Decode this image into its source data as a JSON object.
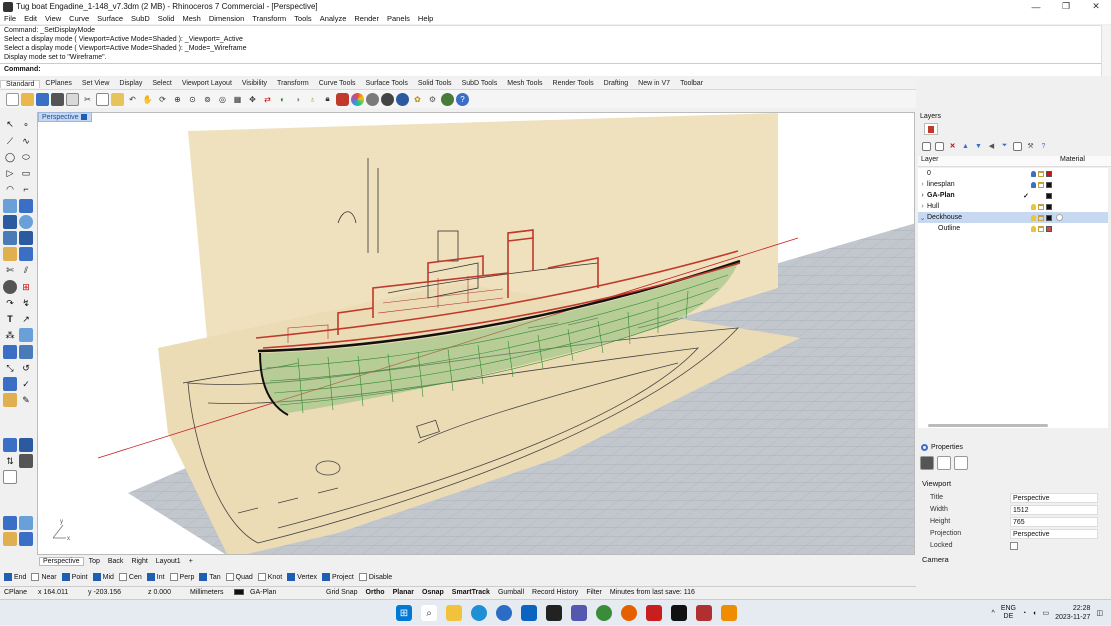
{
  "window": {
    "title": "Tug boat Engadine_1-148_v7.3dm (2 MB) - Rhinoceros 7 Commercial - [Perspective]",
    "minimize": "—",
    "maximize": "❐",
    "close": "✕"
  },
  "menu": [
    "File",
    "Edit",
    "View",
    "Curve",
    "Surface",
    "SubD",
    "Solid",
    "Mesh",
    "Dimension",
    "Transform",
    "Tools",
    "Analyze",
    "Render",
    "Panels",
    "Help"
  ],
  "command_history": [
    "Command: _SetDisplayMode",
    "Select a display mode ( Viewport=Active  Mode=Shaded ): _Viewport=_Active",
    "Select a display mode ( Viewport=Active  Mode=Shaded ): _Mode=_Wireframe",
    "Display mode set to \"Wireframe\"."
  ],
  "command_prompt": "Command:",
  "toolbar_tabs": [
    "Standard",
    "CPlanes",
    "Set View",
    "Display",
    "Select",
    "Viewport Layout",
    "Visibility",
    "Transform",
    "Curve Tools",
    "Surface Tools",
    "Solid Tools",
    "SubD Tools",
    "Mesh Tools",
    "Render Tools",
    "Drafting",
    "New in V7",
    "Toolbar"
  ],
  "toolbar_icons": [
    "new-file-icon",
    "open-icon",
    "save-icon",
    "print-icon",
    "import-icon",
    "cut-icon",
    "copy-icon",
    "paste-icon",
    "undo-icon",
    "pan-icon",
    "rotate-view-icon",
    "zoom-icon",
    "zoom-window-icon",
    "zoom-extents-icon",
    "zoom-selected-icon",
    "grid-icon",
    "move-icon",
    "copy-object-icon",
    "hide-icon",
    "show-icon",
    "lock-icon",
    "layer-icon",
    "color-icon",
    "shaded-icon",
    "rendered-icon",
    "render-icon",
    "mesh-icon",
    "options-icon",
    "help-icon"
  ],
  "viewport": {
    "active_label": "Perspective",
    "tabs": [
      "Perspective",
      "Top",
      "Back",
      "Right",
      "Layout1"
    ],
    "add_tab": "+",
    "axis_label_x": "x",
    "axis_label_y": "y"
  },
  "osnaps": [
    {
      "label": "End",
      "checked": true
    },
    {
      "label": "Near",
      "checked": false
    },
    {
      "label": "Point",
      "checked": true
    },
    {
      "label": "Mid",
      "checked": true
    },
    {
      "label": "Cen",
      "checked": false
    },
    {
      "label": "Int",
      "checked": true
    },
    {
      "label": "Perp",
      "checked": false
    },
    {
      "label": "Tan",
      "checked": true
    },
    {
      "label": "Quad",
      "checked": false
    },
    {
      "label": "Knot",
      "checked": false
    },
    {
      "label": "Vertex",
      "checked": true
    },
    {
      "label": "Project",
      "checked": true
    },
    {
      "label": "Disable",
      "checked": false
    }
  ],
  "status": {
    "cplane": "CPlane",
    "x": "x 164.011",
    "y": "y -203.156",
    "z": "z 0.000",
    "units": "Millimeters",
    "layer": "GA-Plan",
    "toggles": [
      {
        "label": "Grid Snap",
        "bold": false
      },
      {
        "label": "Ortho",
        "bold": true
      },
      {
        "label": "Planar",
        "bold": true
      },
      {
        "label": "Osnap",
        "bold": true
      },
      {
        "label": "SmartTrack",
        "bold": true
      },
      {
        "label": "Gumball",
        "bold": false
      },
      {
        "label": "Record History",
        "bold": false
      },
      {
        "label": "Filter",
        "bold": false
      }
    ],
    "last_save": "Minutes from last save: 116"
  },
  "layers_panel": {
    "title": "Layers",
    "col_layer": "Layer",
    "col_material": "Material",
    "rows": [
      {
        "name": "0",
        "expand": "",
        "current": "",
        "color": "#cc1111",
        "bold": false,
        "selected": false,
        "indent": false,
        "bulb": "blue"
      },
      {
        "name": "linesplan",
        "expand": "›",
        "current": "",
        "color": "#111111",
        "bold": false,
        "selected": false,
        "indent": false,
        "bulb": "blue"
      },
      {
        "name": "GA-Plan",
        "expand": "›",
        "current": "✓",
        "color": "#111111",
        "bold": true,
        "selected": false,
        "indent": false,
        "bulb": "none"
      },
      {
        "name": "Hull",
        "expand": "›",
        "current": "",
        "color": "#111111",
        "bold": false,
        "selected": false,
        "indent": false,
        "bulb": "yellow"
      },
      {
        "name": "Deckhouse",
        "expand": "⌄",
        "current": "",
        "color": "#111111",
        "bold": false,
        "selected": true,
        "indent": false,
        "bulb": "yellow"
      },
      {
        "name": "Outline",
        "expand": "",
        "current": "",
        "color": "#c0504d",
        "bold": false,
        "selected": false,
        "indent": true,
        "bulb": "yellow"
      }
    ]
  },
  "properties_panel": {
    "title": "Properties",
    "section": "Viewport",
    "fields": [
      {
        "label": "Title",
        "value": "Perspective"
      },
      {
        "label": "Width",
        "value": "1512"
      },
      {
        "label": "Height",
        "value": "765"
      },
      {
        "label": "Projection",
        "value": "Perspective"
      },
      {
        "label": "Locked",
        "value": ""
      }
    ],
    "camera_section": "Camera"
  },
  "taskbar": {
    "lang_top": "ENG",
    "lang_bottom": "DE",
    "time": "22:28",
    "date": "2023-11-27",
    "apps": [
      "windows-start-icon",
      "search-icon",
      "file-explorer-icon",
      "edge-icon",
      "app-icon",
      "mail-icon",
      "terminal-icon",
      "teams-icon",
      "chrome-icon",
      "firefox-icon",
      "acrobat-icon",
      "rhino-icon",
      "tool-icon",
      "vlc-icon"
    ]
  }
}
